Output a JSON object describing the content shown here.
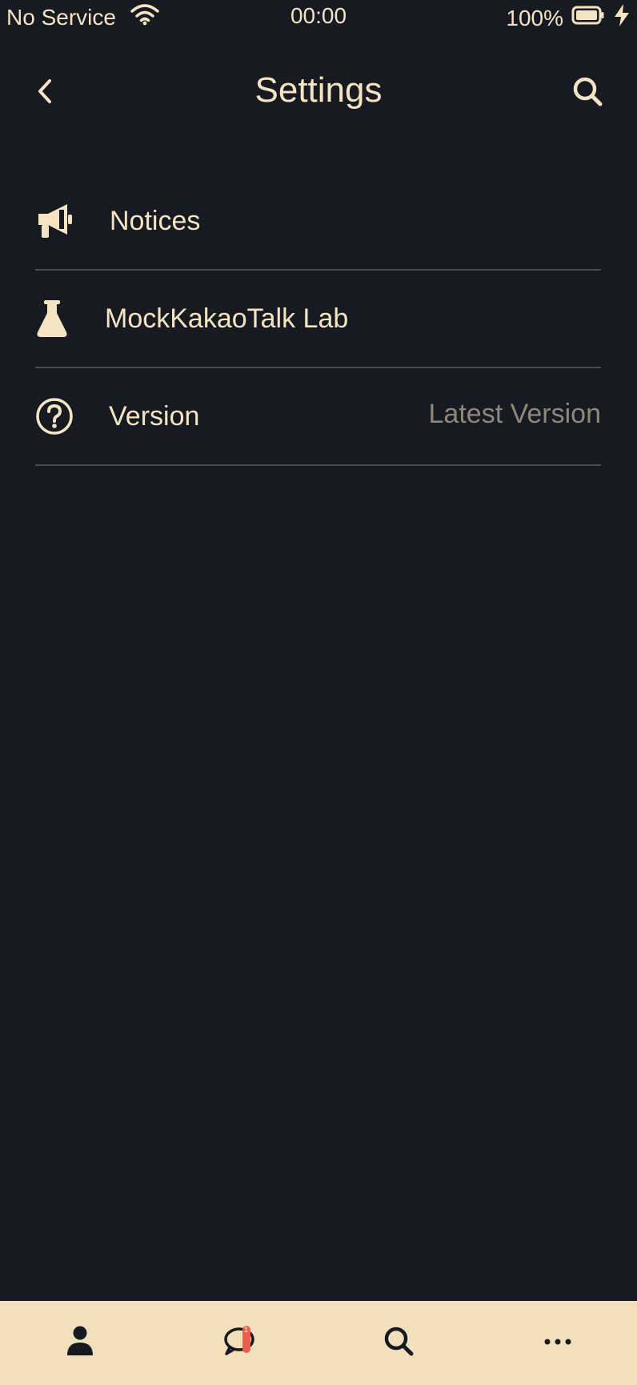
{
  "status_bar": {
    "carrier": "No Service",
    "time": "00:00",
    "battery_percent": "100%"
  },
  "header": {
    "title": "Settings",
    "back_icon": "chevron-left-icon",
    "search_icon": "search-icon"
  },
  "settings": {
    "items": [
      {
        "label": "Notices",
        "icon": "megaphone-icon",
        "value": ""
      },
      {
        "label": "MockKakaoTalk Lab",
        "icon": "flask-icon",
        "value": ""
      },
      {
        "label": "Version",
        "icon": "question-circle-icon",
        "value": "Latest Version"
      }
    ]
  },
  "tab_bar": {
    "tabs": [
      {
        "icon": "person-icon"
      },
      {
        "icon": "chat-bubble-icon",
        "badge": "1"
      },
      {
        "icon": "search-icon"
      },
      {
        "icon": "more-icon"
      }
    ]
  },
  "colors": {
    "background": "#181a21",
    "text": "#f4e4c4",
    "muted_text": "#8e877a",
    "tab_bar": "#f2e0bd",
    "badge": "#e8604c"
  }
}
